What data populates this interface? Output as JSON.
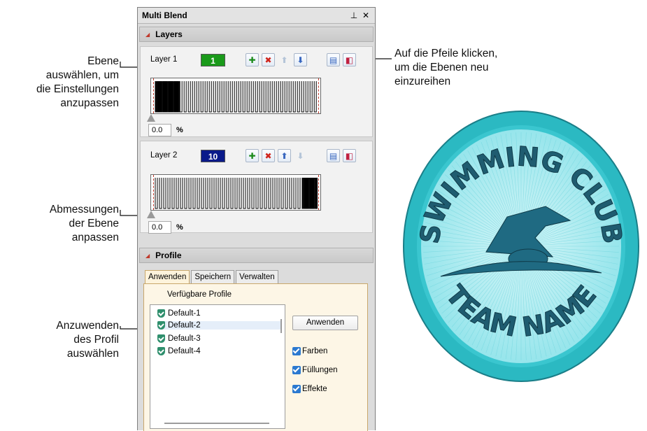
{
  "callouts": {
    "select_layer": [
      "Ebene",
      "auswählen, um",
      "die Einstellungen",
      "anzupassen"
    ],
    "reorder": [
      "Auf die Pfeile klicken,",
      "um die Ebenen neu",
      "einzureihen"
    ],
    "adjust_dims": [
      "Abmessungen",
      "der Ebene",
      "anpassen"
    ],
    "select_profile": [
      "Anzuwenden",
      "des Profil",
      "auswählen"
    ]
  },
  "panel": {
    "title": "Multi Blend",
    "pin_icon": "pin-icon",
    "close_icon": "close-icon",
    "layers_header": "Layers",
    "layers": [
      {
        "name": "Layer 1",
        "number": "1",
        "badge_color": "#1a9a1a",
        "percent": "0.0",
        "percent_sign": "%"
      },
      {
        "name": "Layer 2",
        "number": "10",
        "badge_color": "#0a1a8a",
        "percent": "0.0",
        "percent_sign": "%"
      }
    ],
    "profile_header": "Profile",
    "tabs": [
      "Anwenden",
      "Speichern",
      "Verwalten"
    ],
    "available_label": "Verfügbare Profile",
    "profiles": [
      "Default-1",
      "Default-2",
      "Default-3",
      "Default-4"
    ],
    "apply_button": "Anwenden",
    "options": [
      "Farben",
      "Füllungen",
      "Effekte"
    ]
  },
  "badge": {
    "top_text": "SWIMMING CLUB",
    "bottom_text": "TEAM NAME",
    "colors": {
      "ring": "#2bb9c2",
      "fill": "#8fe3ea",
      "text": "#1f5c70"
    }
  }
}
